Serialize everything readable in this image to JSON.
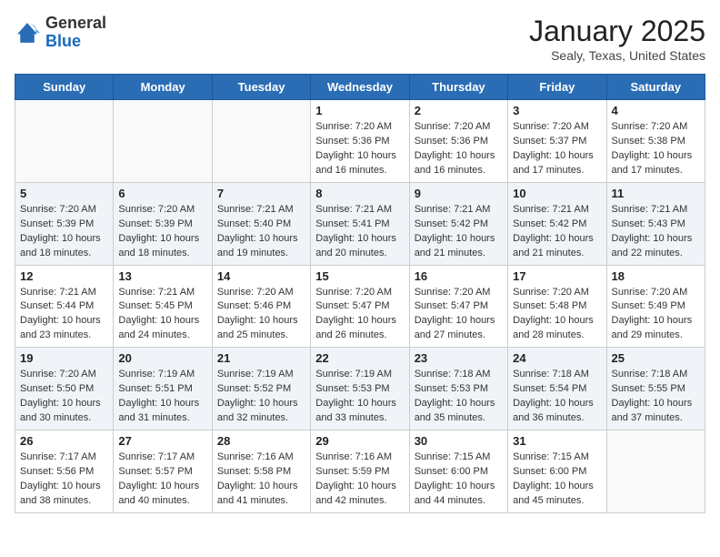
{
  "logo": {
    "general": "General",
    "blue": "Blue"
  },
  "title": "January 2025",
  "location": "Sealy, Texas, United States",
  "days_of_week": [
    "Sunday",
    "Monday",
    "Tuesday",
    "Wednesday",
    "Thursday",
    "Friday",
    "Saturday"
  ],
  "weeks": [
    [
      {
        "day": "",
        "info": ""
      },
      {
        "day": "",
        "info": ""
      },
      {
        "day": "",
        "info": ""
      },
      {
        "day": "1",
        "info": "Sunrise: 7:20 AM\nSunset: 5:36 PM\nDaylight: 10 hours and 16 minutes."
      },
      {
        "day": "2",
        "info": "Sunrise: 7:20 AM\nSunset: 5:36 PM\nDaylight: 10 hours and 16 minutes."
      },
      {
        "day": "3",
        "info": "Sunrise: 7:20 AM\nSunset: 5:37 PM\nDaylight: 10 hours and 17 minutes."
      },
      {
        "day": "4",
        "info": "Sunrise: 7:20 AM\nSunset: 5:38 PM\nDaylight: 10 hours and 17 minutes."
      }
    ],
    [
      {
        "day": "5",
        "info": "Sunrise: 7:20 AM\nSunset: 5:39 PM\nDaylight: 10 hours and 18 minutes."
      },
      {
        "day": "6",
        "info": "Sunrise: 7:20 AM\nSunset: 5:39 PM\nDaylight: 10 hours and 18 minutes."
      },
      {
        "day": "7",
        "info": "Sunrise: 7:21 AM\nSunset: 5:40 PM\nDaylight: 10 hours and 19 minutes."
      },
      {
        "day": "8",
        "info": "Sunrise: 7:21 AM\nSunset: 5:41 PM\nDaylight: 10 hours and 20 minutes."
      },
      {
        "day": "9",
        "info": "Sunrise: 7:21 AM\nSunset: 5:42 PM\nDaylight: 10 hours and 21 minutes."
      },
      {
        "day": "10",
        "info": "Sunrise: 7:21 AM\nSunset: 5:42 PM\nDaylight: 10 hours and 21 minutes."
      },
      {
        "day": "11",
        "info": "Sunrise: 7:21 AM\nSunset: 5:43 PM\nDaylight: 10 hours and 22 minutes."
      }
    ],
    [
      {
        "day": "12",
        "info": "Sunrise: 7:21 AM\nSunset: 5:44 PM\nDaylight: 10 hours and 23 minutes."
      },
      {
        "day": "13",
        "info": "Sunrise: 7:21 AM\nSunset: 5:45 PM\nDaylight: 10 hours and 24 minutes."
      },
      {
        "day": "14",
        "info": "Sunrise: 7:20 AM\nSunset: 5:46 PM\nDaylight: 10 hours and 25 minutes."
      },
      {
        "day": "15",
        "info": "Sunrise: 7:20 AM\nSunset: 5:47 PM\nDaylight: 10 hours and 26 minutes."
      },
      {
        "day": "16",
        "info": "Sunrise: 7:20 AM\nSunset: 5:47 PM\nDaylight: 10 hours and 27 minutes."
      },
      {
        "day": "17",
        "info": "Sunrise: 7:20 AM\nSunset: 5:48 PM\nDaylight: 10 hours and 28 minutes."
      },
      {
        "day": "18",
        "info": "Sunrise: 7:20 AM\nSunset: 5:49 PM\nDaylight: 10 hours and 29 minutes."
      }
    ],
    [
      {
        "day": "19",
        "info": "Sunrise: 7:20 AM\nSunset: 5:50 PM\nDaylight: 10 hours and 30 minutes."
      },
      {
        "day": "20",
        "info": "Sunrise: 7:19 AM\nSunset: 5:51 PM\nDaylight: 10 hours and 31 minutes."
      },
      {
        "day": "21",
        "info": "Sunrise: 7:19 AM\nSunset: 5:52 PM\nDaylight: 10 hours and 32 minutes."
      },
      {
        "day": "22",
        "info": "Sunrise: 7:19 AM\nSunset: 5:53 PM\nDaylight: 10 hours and 33 minutes."
      },
      {
        "day": "23",
        "info": "Sunrise: 7:18 AM\nSunset: 5:53 PM\nDaylight: 10 hours and 35 minutes."
      },
      {
        "day": "24",
        "info": "Sunrise: 7:18 AM\nSunset: 5:54 PM\nDaylight: 10 hours and 36 minutes."
      },
      {
        "day": "25",
        "info": "Sunrise: 7:18 AM\nSunset: 5:55 PM\nDaylight: 10 hours and 37 minutes."
      }
    ],
    [
      {
        "day": "26",
        "info": "Sunrise: 7:17 AM\nSunset: 5:56 PM\nDaylight: 10 hours and 38 minutes."
      },
      {
        "day": "27",
        "info": "Sunrise: 7:17 AM\nSunset: 5:57 PM\nDaylight: 10 hours and 40 minutes."
      },
      {
        "day": "28",
        "info": "Sunrise: 7:16 AM\nSunset: 5:58 PM\nDaylight: 10 hours and 41 minutes."
      },
      {
        "day": "29",
        "info": "Sunrise: 7:16 AM\nSunset: 5:59 PM\nDaylight: 10 hours and 42 minutes."
      },
      {
        "day": "30",
        "info": "Sunrise: 7:15 AM\nSunset: 6:00 PM\nDaylight: 10 hours and 44 minutes."
      },
      {
        "day": "31",
        "info": "Sunrise: 7:15 AM\nSunset: 6:00 PM\nDaylight: 10 hours and 45 minutes."
      },
      {
        "day": "",
        "info": ""
      }
    ]
  ]
}
